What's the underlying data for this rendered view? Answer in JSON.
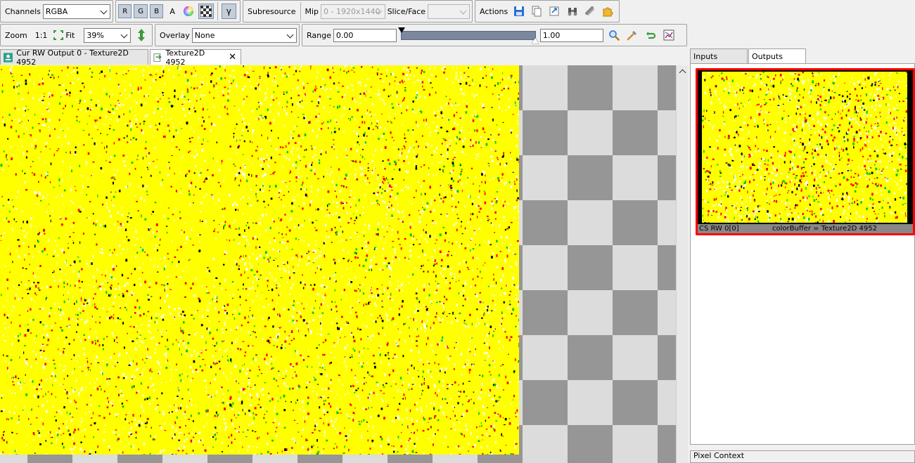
{
  "toolbar1": {
    "channels_label": "Channels",
    "channels_value": "RGBA",
    "channel_r": "R",
    "channel_g": "G",
    "channel_b": "B",
    "channel_a": "A",
    "gamma_label": "γ",
    "subresource_label": "Subresource",
    "mip_label": "Mip",
    "mip_value": "0 - 1920x1440",
    "slice_label": "Slice/Face",
    "slice_value": "",
    "actions_label": "Actions"
  },
  "toolbar2": {
    "zoom_label": "Zoom",
    "zoom_1to1": "1:1",
    "fit_label": "Fit",
    "zoom_value": "39%",
    "overlay_label": "Overlay",
    "overlay_value": "None",
    "range_label": "Range",
    "range_min": "0.00",
    "range_max": "1.00"
  },
  "tabs": [
    {
      "label": "Cur RW Output 0 - Texture2D 4952"
    },
    {
      "label": "Texture2D 4952"
    }
  ],
  "right_panel": {
    "tab_inputs": "Inputs",
    "tab_outputs": "Outputs",
    "thumb_caption_left": "CS RW 0[0]",
    "thumb_caption_right": "colorBuffer = Texture2D 4952",
    "pixel_context_label": "Pixel Context"
  },
  "colors": {
    "texture_fill": "#ffff00",
    "selection_border": "#ff0000",
    "button_active": "#c4ceda"
  }
}
